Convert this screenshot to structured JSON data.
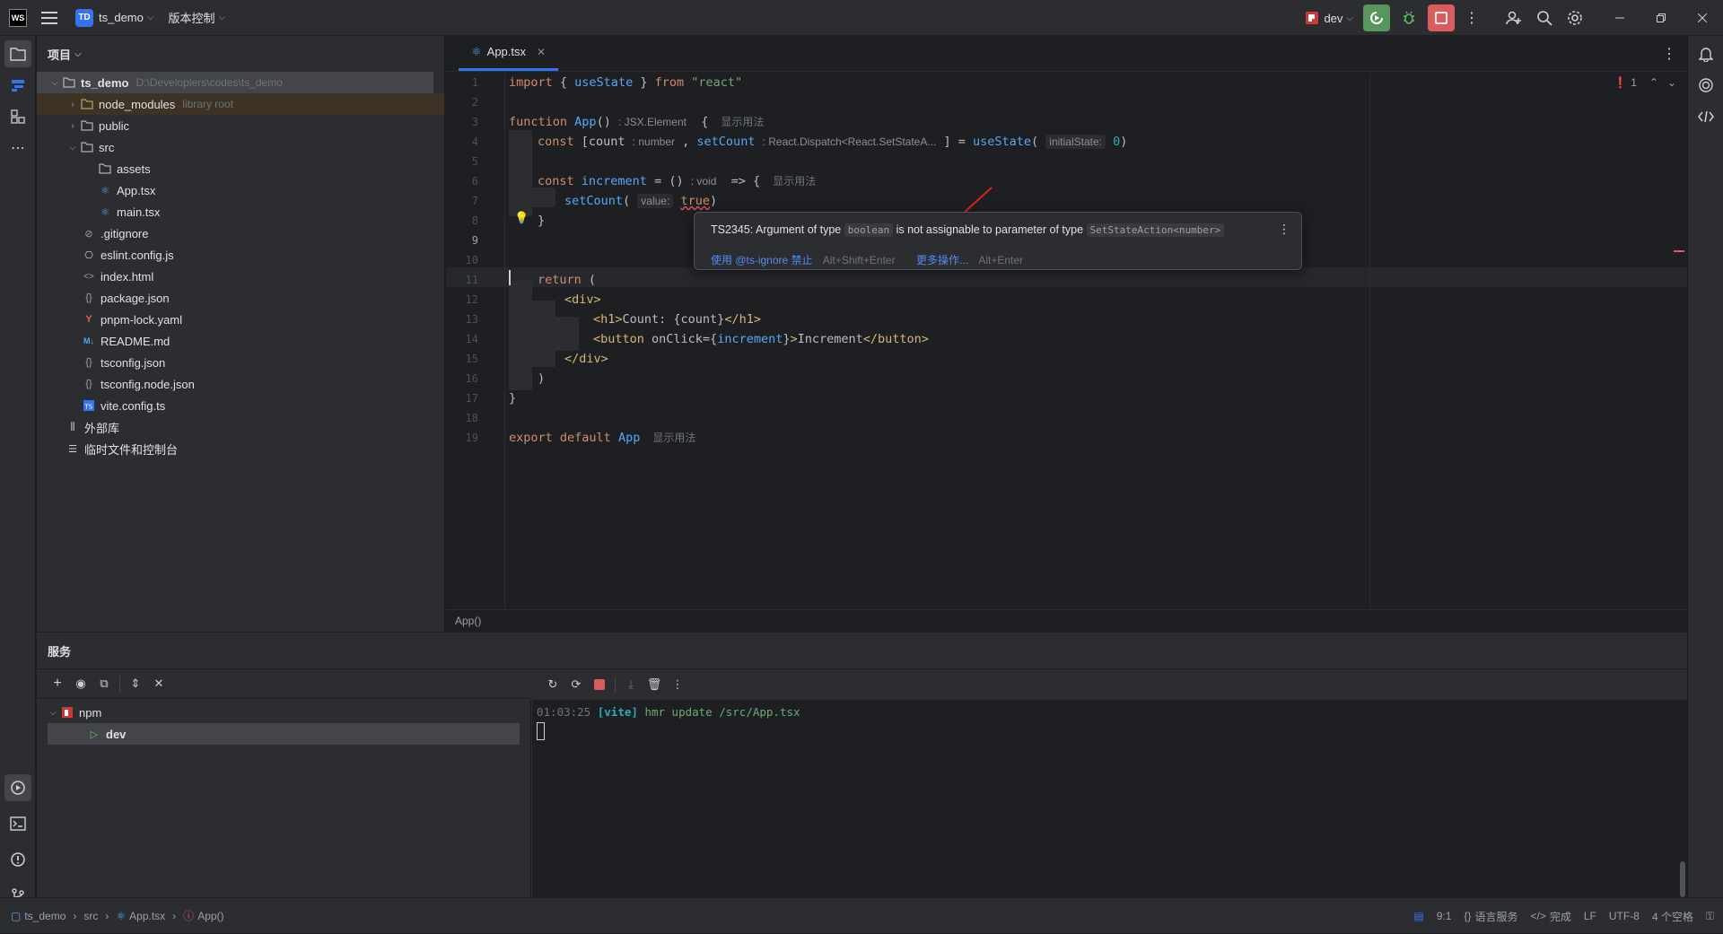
{
  "titlebar": {
    "app_logo": "WS",
    "project_badge": "TD",
    "project_name": "ts_demo",
    "vcs_label": "版本控制",
    "run_config": "dev"
  },
  "project_panel": {
    "title": "项目",
    "root_name": "ts_demo",
    "root_path": "D:\\Developlers\\codes\\ts_demo",
    "items": [
      {
        "label": "node_modules",
        "extra": "library root"
      },
      {
        "label": "public"
      },
      {
        "label": "src"
      },
      {
        "label": "assets"
      },
      {
        "label": "App.tsx"
      },
      {
        "label": "main.tsx"
      },
      {
        "label": ".gitignore"
      },
      {
        "label": "eslint.config.js"
      },
      {
        "label": "index.html"
      },
      {
        "label": "package.json"
      },
      {
        "label": "pnpm-lock.yaml"
      },
      {
        "label": "README.md"
      },
      {
        "label": "tsconfig.json"
      },
      {
        "label": "tsconfig.node.json"
      },
      {
        "label": "vite.config.ts"
      },
      {
        "label": "外部库"
      },
      {
        "label": "临时文件和控制台"
      }
    ]
  },
  "editor": {
    "tab_label": "App.tsx",
    "error_count": "1",
    "line_numbers": [
      "1",
      "2",
      "3",
      "4",
      "5",
      "6",
      "7",
      "8",
      "9",
      "10",
      "11",
      "12",
      "13",
      "14",
      "15",
      "16",
      "17",
      "18",
      "19"
    ],
    "hints": {
      "jsx_element": ": JSX.Element",
      "show_usage": "显示用法",
      "number_type": ": number",
      "dispatch_type": ": React.Dispatch<React.SetStateA...",
      "initial_state": "initialState:",
      "void_type": ": void",
      "value_param": "value:"
    },
    "bottom_crumb": "App()"
  },
  "popup": {
    "msg_prefix": "TS2345: Argument of type",
    "type_chip": "boolean",
    "msg_middle": "is not assignable to parameter of type",
    "target_chip": "SetStateAction<number>",
    "action1": "使用 @ts-ignore 禁止",
    "action1_shortcut": "Alt+Shift+Enter",
    "action2": "更多操作...",
    "action2_shortcut": "Alt+Enter"
  },
  "services": {
    "title": "服务",
    "tree": [
      {
        "label": "npm"
      },
      {
        "label": "dev"
      }
    ],
    "console_time": "01:03:25",
    "console_tag": "[vite]",
    "console_msg": "hmr update /src/App.tsx"
  },
  "statusbar": {
    "crumbs": [
      "ts_demo",
      "src",
      "App.tsx",
      "App()"
    ],
    "position": "9:1",
    "lang_service": "语言服务",
    "done": "完成",
    "line_sep": "LF",
    "encoding": "UTF-8",
    "indent": "4 个空格"
  },
  "colors": {
    "accent": "#3574f0",
    "error": "#e55765",
    "run_green": "#57965c",
    "stop_red": "#db5c5c"
  }
}
